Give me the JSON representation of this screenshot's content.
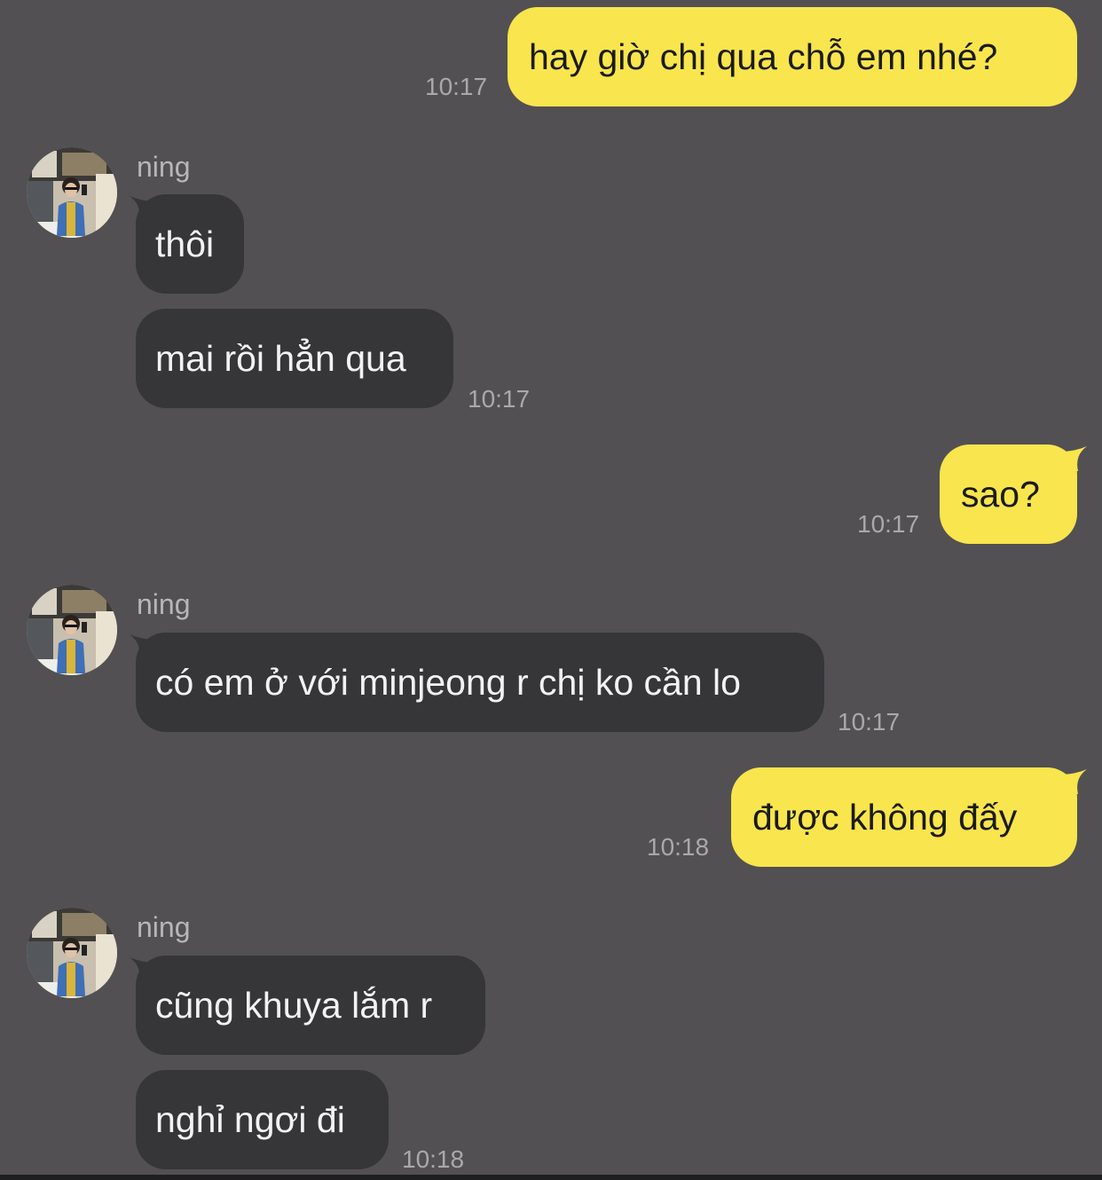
{
  "colors": {
    "background": "#525052",
    "my_bubble": "#F9E54D",
    "their_bubble": "#363538",
    "timestamp": "#a9a8aa"
  },
  "messages": [
    {
      "sender": "me",
      "text": "hay giờ chị qua chỗ em nhé?",
      "time": "10:17"
    },
    {
      "sender": "ning",
      "name": "ning",
      "avatar": "avatar-photo",
      "text": "thôi"
    },
    {
      "sender": "ning",
      "text": "mai rồi hẳn qua",
      "time": "10:17"
    },
    {
      "sender": "me",
      "text": "sao?",
      "time": "10:17"
    },
    {
      "sender": "ning",
      "name": "ning",
      "avatar": "avatar-photo",
      "text": "có em ở với minjeong r chị ko cần lo",
      "time": "10:17"
    },
    {
      "sender": "me",
      "text": "được không đấy",
      "time": "10:18"
    },
    {
      "sender": "ning",
      "name": "ning",
      "avatar": "avatar-photo",
      "text": "cũng khuya lắm r"
    },
    {
      "sender": "ning",
      "text": "nghỉ ngơi đi",
      "time": "10:18"
    }
  ]
}
